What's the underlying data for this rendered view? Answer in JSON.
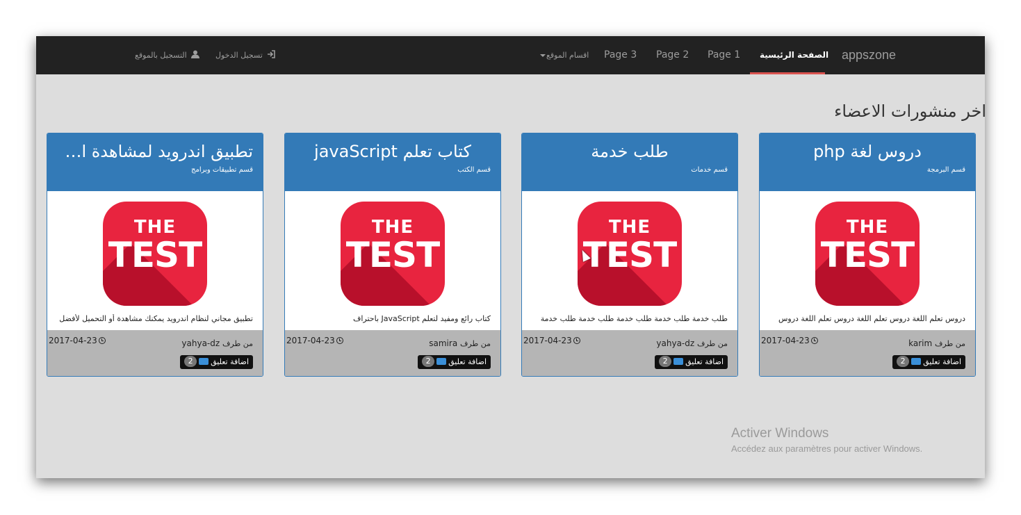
{
  "navbar": {
    "brand": "appszone",
    "active_item": "الصفحة الرئيسية",
    "pages": [
      "Page 1",
      "Page 2",
      "Page 3"
    ],
    "sections_dropdown": "اقسام الموقع",
    "login": "تسجيل الدخول",
    "register": "التسجيل بالموقع",
    "active_color": "#d9534f"
  },
  "section_title": "اخر منشورات الاعضاء",
  "card_image": {
    "line1": "THE",
    "line2": "TEST"
  },
  "cards": [
    {
      "title": "دروس لغة php",
      "category": "قسم البرمجة",
      "description": "دروس تعلم اللغة دروس تعلم اللغة دروس تعلم اللغة دروس",
      "author_prefix": "من طرف",
      "author": "karim",
      "date": "2017-04-23",
      "comment_label": "اضافة تعليق",
      "comment_count": "2"
    },
    {
      "title": "طلب خدمة",
      "category": "قسم خدمات",
      "description": "طلب خدمة طلب خدمة طلب خدمة طلب خدمة طلب خدمة",
      "author_prefix": "من طرف",
      "author": "yahya-dz",
      "date": "2017-04-23",
      "comment_label": "اضافة تعليق",
      "comment_count": "2"
    },
    {
      "title": "كتاب تعلم javaScript",
      "category": "قسم الكتب",
      "description": "كتاب رائع ومفيد لتعلم JavaScript باحتراف",
      "author_prefix": "من طرف",
      "author": "samira",
      "date": "2017-04-23",
      "comment_label": "اضافة تعليق",
      "comment_count": "2"
    },
    {
      "title": "تطبيق اندرويد لمشاهدة الا...",
      "category": "قسم تطبيقات وبرامج",
      "description": "تطبيق مجاني لنظام اندرويد يمكنك مشاهدة أو التحميل لأفضل",
      "author_prefix": "من طرف",
      "author": "yahya-dz",
      "date": "2017-04-23",
      "comment_label": "اضافة تعليق",
      "comment_count": "2"
    }
  ],
  "watermark": {
    "line1": "Activer Windows",
    "line2": "Accédez aux paramètres pour activer Windows."
  }
}
